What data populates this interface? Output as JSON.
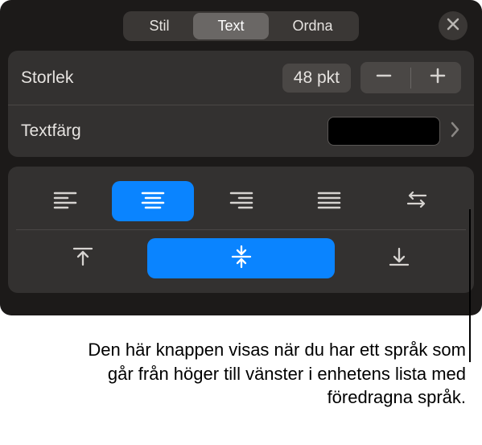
{
  "tabs": {
    "stil": "Stil",
    "text": "Text",
    "ordna": "Ordna"
  },
  "size": {
    "label": "Storlek",
    "value": "48 pkt"
  },
  "color": {
    "label": "Textfärg",
    "swatch": "#000000"
  },
  "caption": "Den här knappen visas när du har ett språk som går från höger till vänster i enhetens lista med föredragna språk."
}
